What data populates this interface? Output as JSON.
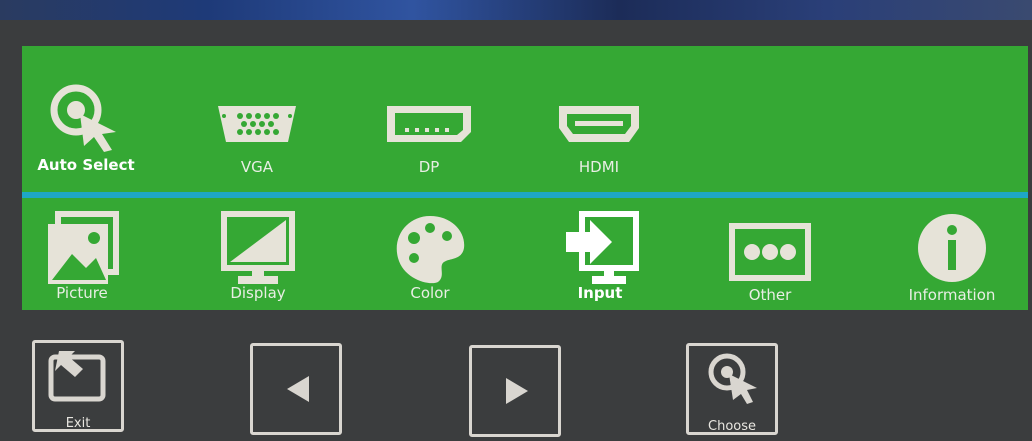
{
  "sources": [
    {
      "id": "auto",
      "label": "Auto Select",
      "icon": "auto-select-icon",
      "selected": true
    },
    {
      "id": "vga",
      "label": "VGA",
      "icon": "vga-port-icon",
      "selected": false
    },
    {
      "id": "dp",
      "label": "DP",
      "icon": "displayport-icon",
      "selected": false
    },
    {
      "id": "hdmi",
      "label": "HDMI",
      "icon": "hdmi-port-icon",
      "selected": false
    }
  ],
  "menu": [
    {
      "id": "picture",
      "label": "Picture",
      "icon": "picture-icon"
    },
    {
      "id": "display",
      "label": "Display",
      "icon": "display-icon"
    },
    {
      "id": "color",
      "label": "Color",
      "icon": "palette-icon"
    },
    {
      "id": "input",
      "label": "Input",
      "icon": "input-icon",
      "active": true
    },
    {
      "id": "other",
      "label": "Other",
      "icon": "other-icon"
    },
    {
      "id": "information",
      "label": "Information",
      "icon": "info-icon"
    }
  ],
  "buttons": [
    {
      "id": "exit",
      "label": "Exit",
      "icon": "exit-icon"
    },
    {
      "id": "left",
      "label": "",
      "icon": "arrow-left-icon"
    },
    {
      "id": "right",
      "label": "",
      "icon": "arrow-right-icon"
    },
    {
      "id": "choose",
      "label": "Choose",
      "icon": "choose-icon"
    }
  ],
  "colors": {
    "osd_green": "#35a834",
    "divider_cyan": "#1ea7c5",
    "icon_cream": "#e6e3d8",
    "bezel": "#3b3d3e"
  }
}
